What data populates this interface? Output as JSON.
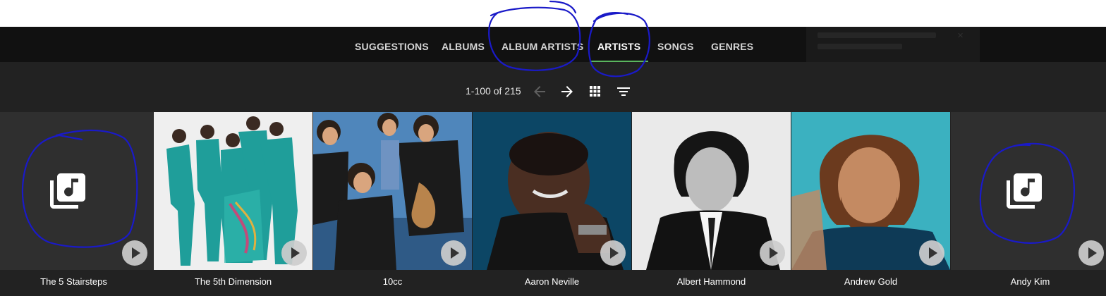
{
  "tabs": [
    {
      "label": "SUGGESTIONS",
      "active": false
    },
    {
      "label": "ALBUMS",
      "active": false
    },
    {
      "label": "ALBUM ARTISTS",
      "active": false
    },
    {
      "label": "ARTISTS",
      "active": true
    },
    {
      "label": "SONGS",
      "active": false
    },
    {
      "label": "GENRES",
      "active": false
    }
  ],
  "toolbar": {
    "page_info": "1-100 of 215",
    "icons": [
      "arrow-back-icon",
      "arrow-forward-icon",
      "grid-view-icon",
      "filter-sort-icon"
    ]
  },
  "artists": [
    {
      "name": "The 5 Stairsteps",
      "image": "placeholder"
    },
    {
      "name": "The 5th Dimension",
      "image": "photo"
    },
    {
      "name": "10cc",
      "image": "photo"
    },
    {
      "name": "Aaron Neville",
      "image": "photo"
    },
    {
      "name": "Albert Hammond",
      "image": "photo"
    },
    {
      "name": "Andrew Gold",
      "image": "photo"
    },
    {
      "name": "Andy Kim",
      "image": "placeholder"
    }
  ],
  "colors": {
    "tabbar_bg": "#111111",
    "content_bg": "#222222",
    "active_underline": "#5ab55e",
    "annotation_ink": "#1a1ac8"
  }
}
